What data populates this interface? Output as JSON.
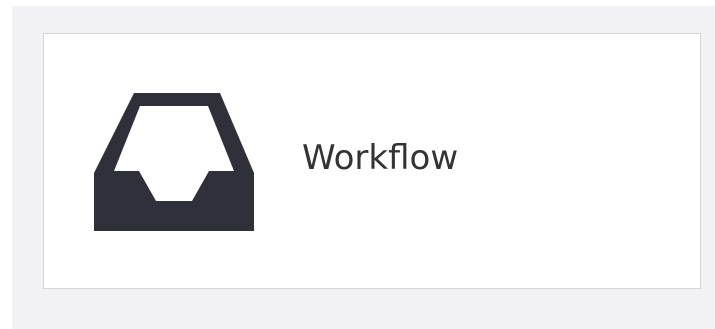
{
  "card": {
    "label": "Workflow",
    "icon": "inbox-tray-icon",
    "colors": {
      "icon": "#30303a",
      "text": "#333333",
      "border": "#d4d4d9",
      "panel_background": "#f2f2f5",
      "card_background": "#ffffff"
    }
  }
}
